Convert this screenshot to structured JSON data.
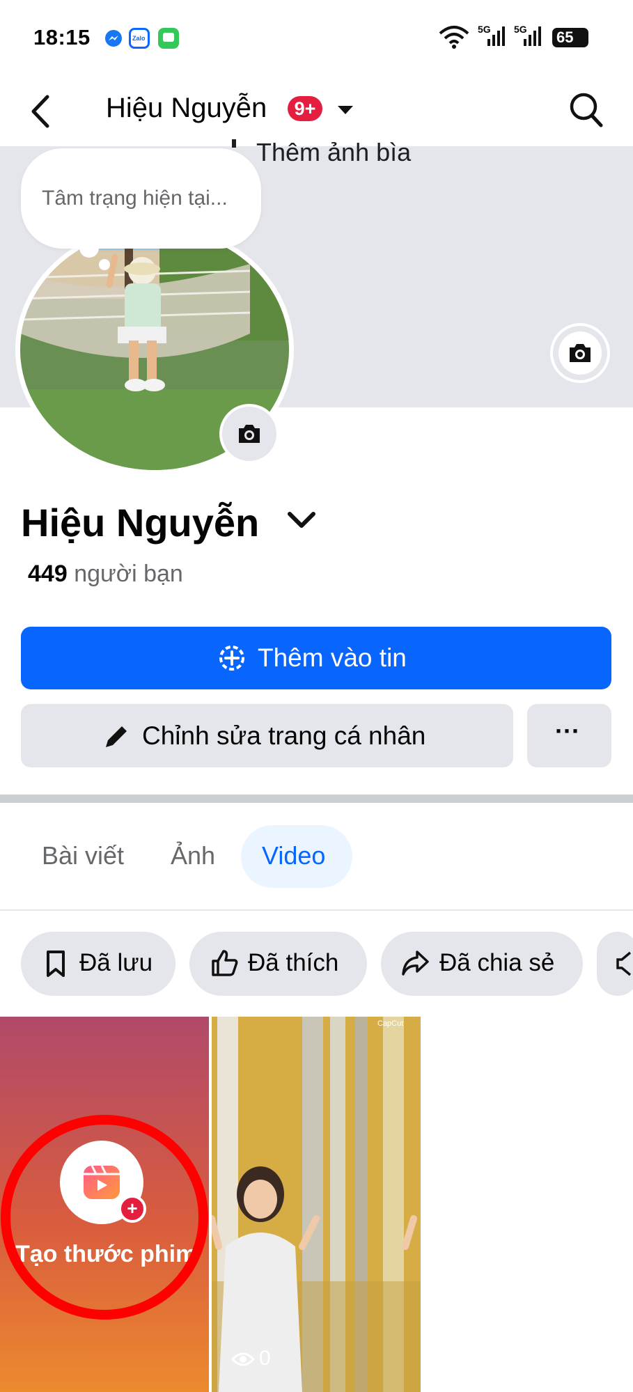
{
  "status_bar": {
    "time": "18:15",
    "apps": [
      "messenger-icon",
      "zalo-icon",
      "messages-icon"
    ],
    "zalo_label": "Zalo",
    "signal_label": "5G",
    "battery": "65"
  },
  "nav": {
    "profile_name": "Hiệu Nguyễn",
    "notification_count": "9+"
  },
  "cover": {
    "add_cover_label": "Thêm ảnh bìa",
    "mood_placeholder": "Tâm trạng hiện tại..."
  },
  "profile": {
    "name": "Hiệu Nguyễn",
    "friends_count": "449",
    "friends_label": "người bạn"
  },
  "actions": {
    "add_story": "Thêm vào tin",
    "edit_profile": "Chỉnh sửa trang cá nhân",
    "more": "···"
  },
  "tabs": [
    {
      "label": "Bài viết",
      "selected": false
    },
    {
      "label": "Ảnh",
      "selected": false
    },
    {
      "label": "Video",
      "selected": true
    }
  ],
  "filters": [
    {
      "label": "Đã lưu",
      "icon": "bookmark-icon"
    },
    {
      "label": "Đã thích",
      "icon": "thumbs-up-icon"
    },
    {
      "label": "Đã chia sẻ",
      "icon": "share-icon"
    }
  ],
  "videos": {
    "create_label": "Tạo thước phim",
    "items": [
      {
        "views": "0",
        "watermark": "CapCut"
      }
    ]
  },
  "colors": {
    "accent": "#0866ff",
    "badge": "#e41e3f",
    "annotation": "#ff0000"
  }
}
